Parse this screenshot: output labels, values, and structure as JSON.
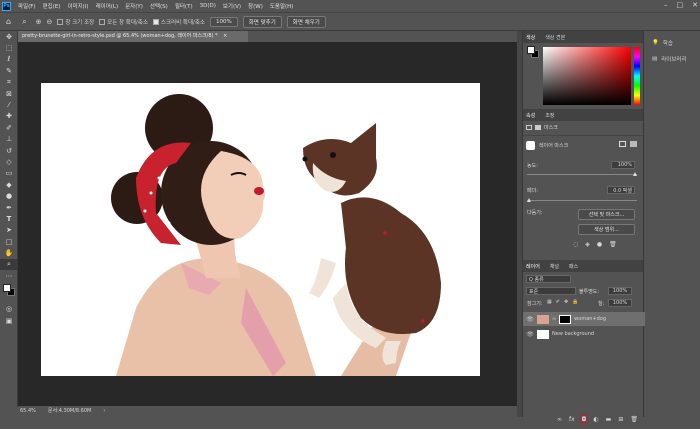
{
  "menubar": {
    "app_icon": "Ps",
    "items": [
      "파일(F)",
      "편집(E)",
      "이미지(I)",
      "레이어(L)",
      "문자(Y)",
      "선택(S)",
      "필터(T)",
      "3D(D)",
      "보기(V)",
      "창(W)",
      "도움말(H)"
    ],
    "window_controls": [
      "–",
      "□",
      "✕"
    ]
  },
  "options": {
    "resize_windows": "창 크기 조정",
    "zoom_all_windows": "모든 창 확대/축소",
    "scrubby_zoom": "스크러비 확대/축소",
    "zoom_value": "100%",
    "fit_screen": "화면 맞추기",
    "fill_screen": "화면 채우기"
  },
  "document": {
    "tab_title": "pretty-brunette-girl-in-retro-style.psd @ 65.4% (woman+dog, 레이어 마스크/8) *",
    "tab_close": "×",
    "zoom_status": "65.4%",
    "doc_status": "문서:4.30M/8.60M",
    "status_arrow": "›"
  },
  "panels": {
    "color_tabs": [
      "색상",
      "색상 견본"
    ],
    "properties_tabs": [
      "속성",
      "조정"
    ],
    "mask_label": "마스크",
    "layer_mask_label": "레이어 마스크",
    "density_label": "농도:",
    "density_value": "100%",
    "feather_label": "페더:",
    "feather_value": "0.0 픽셀",
    "refine_label": "다듬기:",
    "select_mask_button": "선택 및 마스크...",
    "color_range_button": "색상 범위...",
    "layers_tabs": [
      "레이어",
      "채널",
      "패스"
    ],
    "kind_filter": "Q 종류",
    "blend_mode": "표준",
    "opacity_label": "불투명도:",
    "opacity_value": "100%",
    "lock_label": "잠그기:",
    "fill_label": "칠:",
    "fill_value": "100%",
    "layers": [
      {
        "name": "woman+dog"
      },
      {
        "name": "New background"
      }
    ]
  },
  "far_right": {
    "items": [
      "학습",
      "라이브러리"
    ]
  },
  "colors": {
    "highlight": "#cc1a1a",
    "accent": "#31a8ff"
  }
}
